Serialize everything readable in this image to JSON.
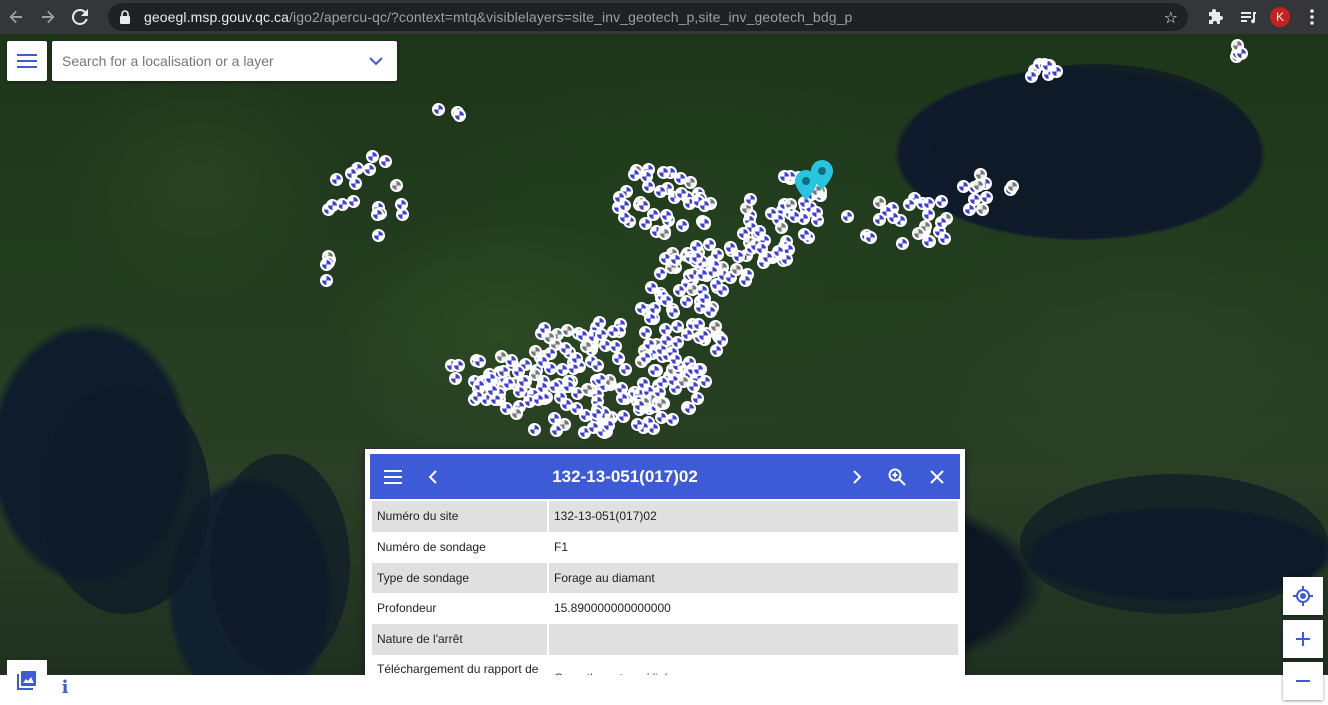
{
  "browser": {
    "url_host": "geoegl.msp.gouv.qc.ca",
    "url_path": "/igo2/apercu-qc/?context=mtq&visiblelayers=site_inv_geotech_p,site_inv_geotech_bdg_p",
    "profile_initial": "K",
    "icons": [
      "back-arrow-icon",
      "forward-arrow-icon",
      "reload-icon",
      "lock-icon",
      "star-icon",
      "extensions-icon",
      "reading-list-icon",
      "kebab-menu-icon"
    ]
  },
  "search": {
    "placeholder": "Search for a localisation or a layer"
  },
  "panel": {
    "title": "132-13-051(017)02",
    "rows": [
      {
        "label": "Numéro du site",
        "value": "132-13-051(017)02"
      },
      {
        "label": "Numéro de sondage",
        "value": "F1"
      },
      {
        "label": "Type de sondage",
        "value": "Forage au diamant"
      },
      {
        "label": "Profondeur",
        "value": "15.890000000000000"
      },
      {
        "label": "Nature de l'arrêt",
        "value": ""
      },
      {
        "label": "Téléchargement du rapport de sondage (Pdf)",
        "value": "Open the external link"
      }
    ]
  },
  "bottom": {
    "info_label": "i"
  },
  "colors": {
    "accent": "#3d5bd6",
    "marker_blue": "#3f3fd8",
    "selected_pin": "#29c5e0"
  }
}
